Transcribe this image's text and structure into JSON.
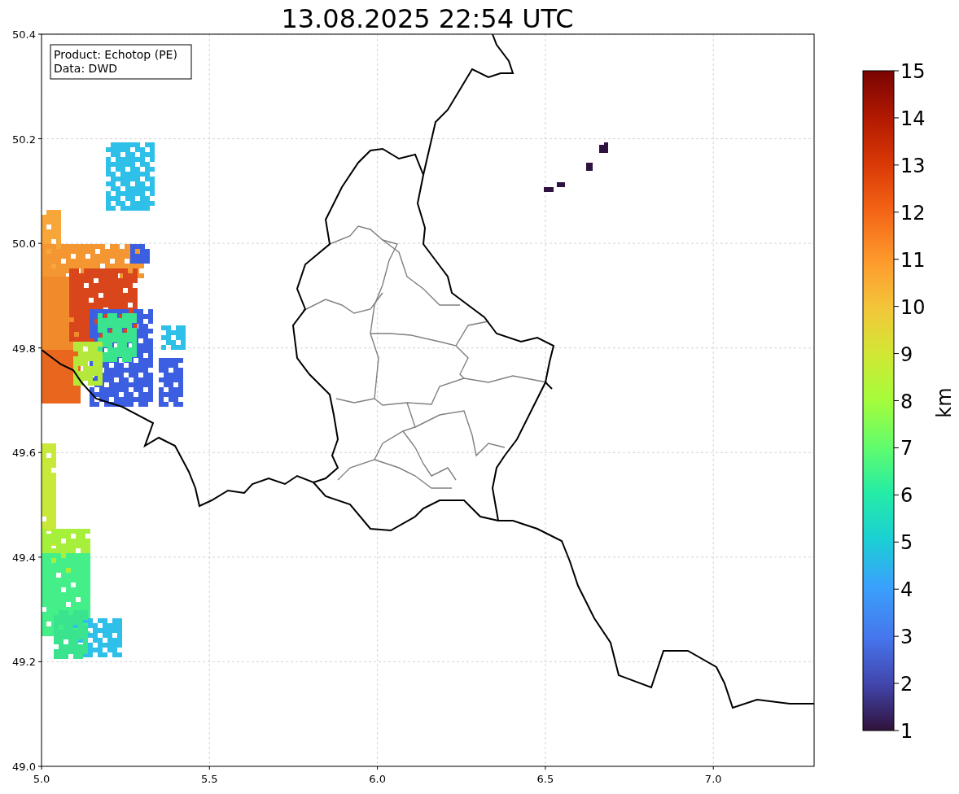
{
  "title": "13.08.2025 22:54 UTC",
  "info_box": [
    "Product: Echotop (PE)",
    "Data: DWD"
  ],
  "map": {
    "x_ticks": [
      "5.0",
      "5.5",
      "6.0",
      "6.5",
      "7.0"
    ],
    "y_ticks": [
      "50.4",
      "50.2",
      "50.0",
      "49.8",
      "49.6",
      "49.4",
      "49.2",
      "49.0"
    ]
  },
  "colorbar": {
    "label": "km",
    "ticks": [
      "15",
      "14",
      "13",
      "12",
      "11",
      "10",
      "9",
      "8",
      "7",
      "6",
      "5",
      "4",
      "3",
      "2",
      "1"
    ]
  }
}
